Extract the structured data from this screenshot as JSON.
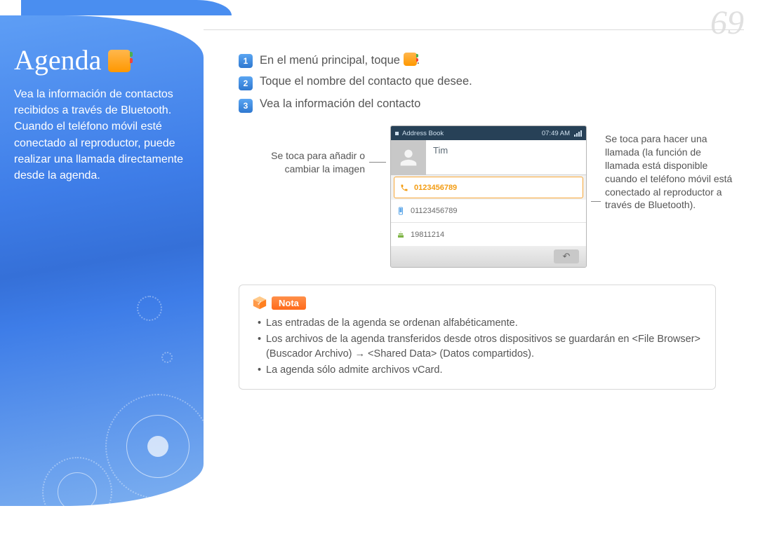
{
  "page_number": "69",
  "sidebar": {
    "title": "Agenda",
    "desc": "Vea la información de contactos recibidos a través de Bluetooth.\nCuando el teléfono móvil esté conectado al reproductor, puede realizar una llamada directamente desde la agenda."
  },
  "steps": [
    {
      "n": "1",
      "text_pre": "En el menú principal, toque ",
      "text_post": "."
    },
    {
      "n": "2",
      "text": "Toque el nombre del contacto que desee."
    },
    {
      "n": "3",
      "text": "Vea la información del contacto"
    }
  ],
  "callouts": {
    "left": "Se toca para añadir o cambiar la imagen",
    "right": "Se toca para hacer una llamada (la función de llamada está disponible cuando el teléfono móvil está conectado al reproductor a través de Bluetooth)."
  },
  "mock": {
    "status_title": "Address Book",
    "status_time": "07:49 AM",
    "name": "Tim",
    "phone_highlight": "0123456789",
    "phone2": "01123456789",
    "birthday": "19811214"
  },
  "note": {
    "label": "Nota",
    "items": [
      "Las entradas de la agenda se ordenan alfabéticamente.",
      "Los archivos de la agenda transferidos desde otros dispositivos se guardarán en <File Browser> (Buscador Archivo) → <Shared Data> (Datos compartidos).",
      "La agenda sólo admite archivos vCard."
    ]
  }
}
